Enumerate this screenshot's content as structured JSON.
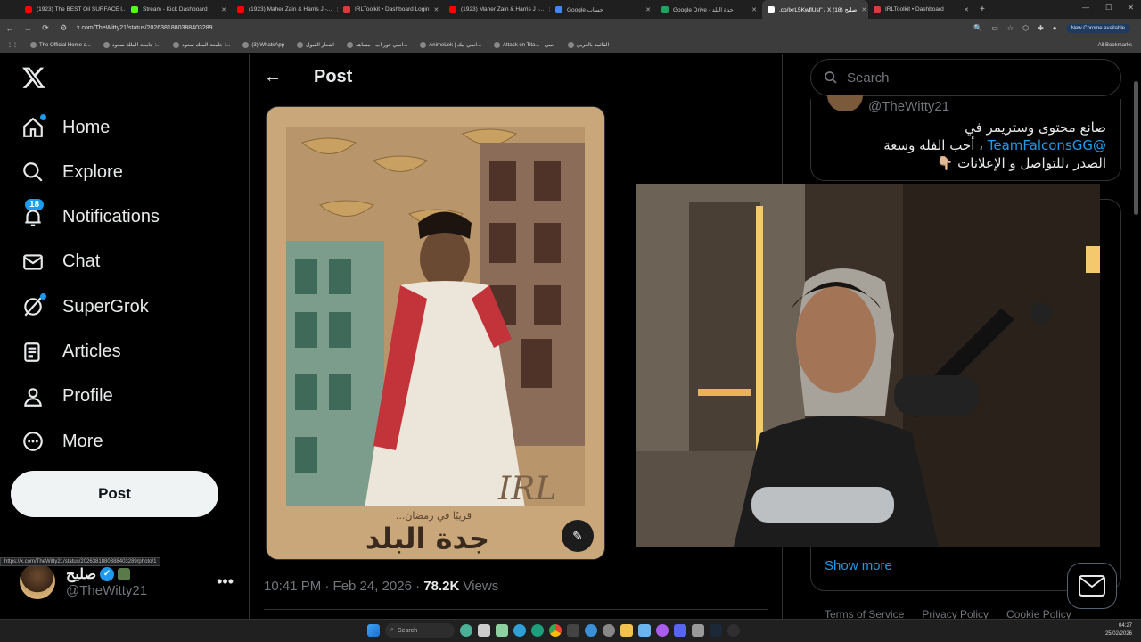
{
  "browser": {
    "tabs": [
      {
        "title": "(1923) The BEST Oil SURFACE l...",
        "color": "#ff0000",
        "active": false
      },
      {
        "title": "Stream - Kick Dashboard",
        "color": "#53fc18",
        "active": false
      },
      {
        "title": "(1923) Maher Zain & Harris J -...",
        "color": "#ff0000",
        "active": false
      },
      {
        "title": "IRLToolkit • Dashboard Login",
        "color": "#d83b3b",
        "active": false
      },
      {
        "title": "(1923) Maher Zain & Harris J -...",
        "color": "#ff0000",
        "active": false
      },
      {
        "title": "Google حساب",
        "color": "#4285f4",
        "active": false
      },
      {
        "title": "Google Drive - جدة البلد",
        "color": "#1fa463",
        "active": false
      },
      {
        "title": ".co/lxrL5KwflUsl\" / X صليح (18)",
        "color": "#ffffff",
        "active": true
      },
      {
        "title": "IRLToolkit • Dashboard",
        "color": "#d83b3b",
        "active": false
      }
    ],
    "new_tab": "+",
    "url": "x.com/TheWitty21/status/2026381880388403289",
    "update_label": "New Chrome available",
    "bookmarks": [
      "The Official Home o...",
      "جامعة الملك سعود :...",
      "جامعة الملك سعود :...",
      "(3) WhatsApp",
      "اشعار القبول",
      "انمي فور اب - مشاهد...",
      "AnimeLek | انمي ليك...",
      "Attack on Tita... - انمي",
      "القائمة بالعربي"
    ],
    "all_bookmarks": "All Bookmarks",
    "status_url": "https://x.com/TheWitty21/status/2026381880388403289/photo/1"
  },
  "nav": {
    "items": [
      {
        "label": "Home",
        "icon": "home-icon",
        "dot": true
      },
      {
        "label": "Explore",
        "icon": "search-icon"
      },
      {
        "label": "Notifications",
        "icon": "bell-icon",
        "badge": "18"
      },
      {
        "label": "Chat",
        "icon": "mail-icon"
      },
      {
        "label": "SuperGrok",
        "icon": "grok-icon",
        "dot": true
      },
      {
        "label": "Articles",
        "icon": "article-icon"
      },
      {
        "label": "Profile",
        "icon": "person-icon"
      },
      {
        "label": "More",
        "icon": "more-circle-icon"
      }
    ],
    "post_button": "Post",
    "account": {
      "name": "صليح",
      "handle": "@TheWitty21"
    }
  },
  "main": {
    "title": "Post",
    "image_text": {
      "title": "جدة البلد",
      "subtitle": "قريبًا في رمضان...",
      "logo": "IRL"
    },
    "meta": {
      "time": "10:41 PM · Feb 24, 2026 · ",
      "views_count": "78.2K",
      "views_label": " Views"
    }
  },
  "sidebar": {
    "search_placeholder": "Search",
    "profile_handle": "@TheWitty21",
    "bio_line1": "صانع محتوى وستريمر في",
    "bio_line2_mention": "@TeamFalconsGG",
    "bio_line2_rest": " ، أحب الفله وسعة",
    "bio_line3": "الصدر ،للتواصل و الإعلانات 👇🏼",
    "show_more": "Show more",
    "footer": [
      "Terms of Service",
      "Privacy Policy",
      "Cookie Policy"
    ]
  },
  "taskbar": {
    "search": "Search",
    "time": "04:27",
    "date": "25/02/2026"
  },
  "colors": {
    "accent": "#1d9bf0",
    "bg": "#000000",
    "border": "#2f3336",
    "muted": "#71767b"
  }
}
